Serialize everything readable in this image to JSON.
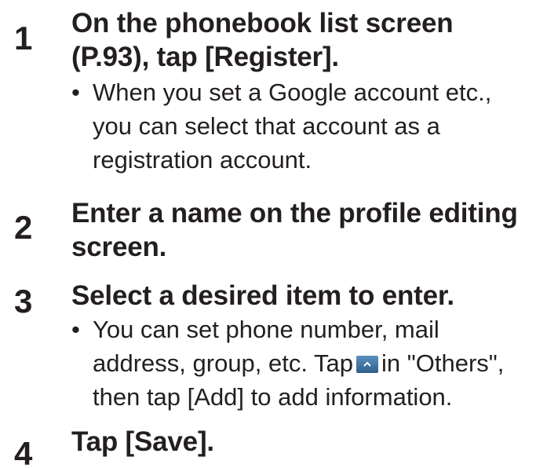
{
  "steps": [
    {
      "number": "1",
      "title_lines": [
        "On the phonebook list screen",
        "(P.93), tap [Register]."
      ],
      "bullet": {
        "marker": "•",
        "lines": [
          "When you set a Google account etc.,",
          "you can select that account as a",
          "registration account."
        ]
      }
    },
    {
      "number": "2",
      "title_lines": [
        "Enter a name on the profile editing",
        "screen."
      ]
    },
    {
      "number": "3",
      "title_lines": [
        "Select a desired item to enter."
      ],
      "bullet": {
        "marker": "•",
        "line1": "You can set phone number, mail",
        "line2_before_icon": "address, group, etc. Tap",
        "line2_after_icon": "in \"Others\",",
        "line3": "then tap [Add] to add information.",
        "icon": "expand-up-icon"
      }
    },
    {
      "number": "4",
      "title_lines": [
        "Tap [Save]."
      ]
    }
  ],
  "colors": {
    "text": "#231f20",
    "icon_bg": "#3f6f9c"
  }
}
